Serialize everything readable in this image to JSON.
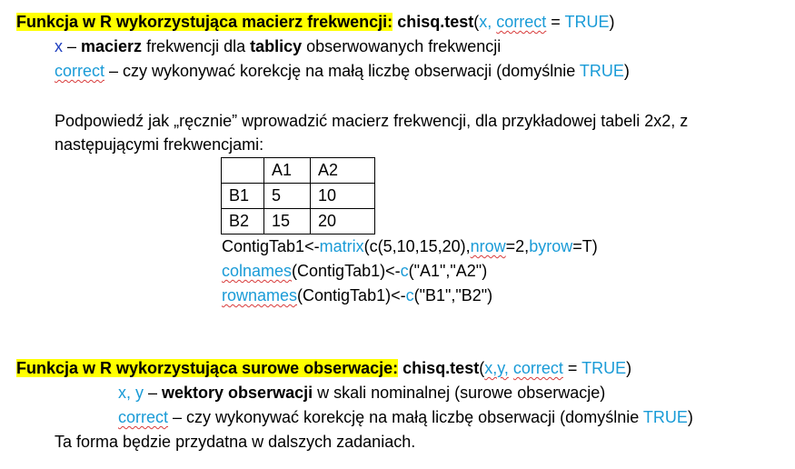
{
  "colors": {
    "highlight": "#ffff00",
    "keyword": "#1a9bd7",
    "param_x": "#1f3fbf"
  },
  "section1": {
    "title": "Funkcja w R wykorzystująca macierz frekwencji:",
    "fn": "chisq.test",
    "args_open": "(",
    "arg_x": "x,",
    "arg_correct": "correct",
    "eq": " = ",
    "true_val": "TRUE",
    "args_close": ")",
    "x_label": "x",
    "x_dash": " – ",
    "x_bold1": "macierz",
    "x_mid": " frekwencji dla ",
    "x_bold2": "tablicy",
    "x_end": " obserwowanych frekwencji",
    "correct_label": "correct",
    "correct_text": " – czy wykonywać korekcję na małą liczbę obserwacji (domyślnie ",
    "correct_true": "TRUE",
    "correct_close": ")"
  },
  "hint": {
    "line1": "Podpowiedź jak „ręcznie” wprowadzić macierz frekwencji, dla przykładowej tabeli 2x2, z",
    "line2": "następującymi frekwencjami:"
  },
  "table": {
    "header": [
      "",
      "A1",
      "A2"
    ],
    "rows": [
      [
        "B1",
        "5",
        "10"
      ],
      [
        "B2",
        "15",
        "20"
      ]
    ]
  },
  "code": {
    "l1_a": "ContigTab1<-",
    "l1_fn": "matrix",
    "l1_b": "(c(5,10,15,20),",
    "l1_nrow": "nrow",
    "l1_c": "=2,",
    "l1_byrow": "byrow",
    "l1_d": "=T)",
    "l2_fn": "colnames",
    "l2_a": "(ContigTab1)<-",
    "l2_c": "c",
    "l2_b": "(\"A1\",\"A2\")",
    "l3_fn": "rownames",
    "l3_a": "(ContigTab1)<-",
    "l3_c": "c",
    "l3_b": "(\"B1\",\"B2\")"
  },
  "section2": {
    "title": "Funkcja w R wykorzystująca surowe obserwacje:",
    "fn": "chisq.test",
    "args_open": "(",
    "arg_xy": "x,y,",
    "arg_correct": "correct",
    "eq": " = ",
    "true_val": "TRUE",
    "args_close": ")",
    "xy_label": "x, y",
    "xy_dash": " – ",
    "xy_bold": "wektory obserwacji",
    "xy_end": " w skali nominalnej (surowe obserwacje)",
    "correct_label": "correct",
    "correct_text": " – czy wykonywać korekcję na małą liczbę obserwacji (domyślnie ",
    "correct_true": "TRUE",
    "correct_close": ")",
    "note": "Ta forma będzie przydatna w dalszych zadaniach."
  }
}
